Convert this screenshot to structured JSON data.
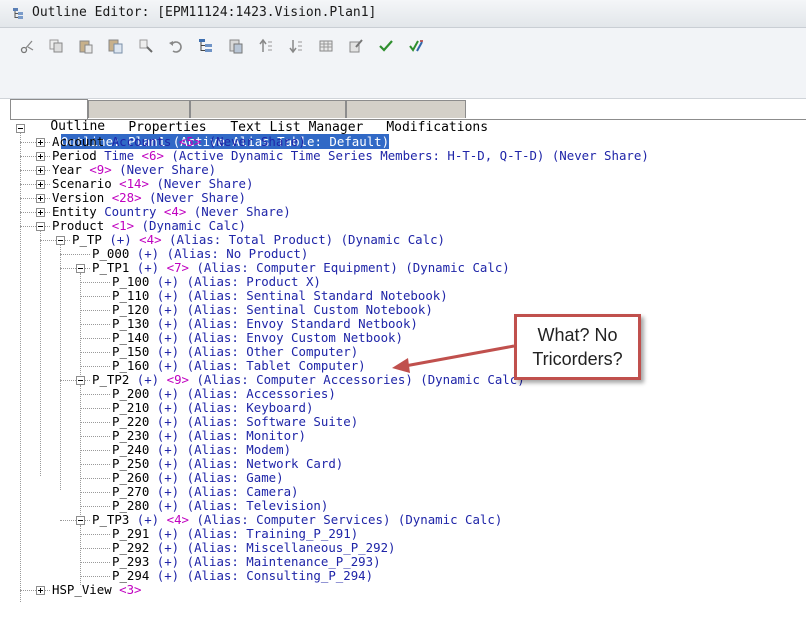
{
  "window": {
    "title": "Outline Editor: [EPM11124:1423.Vision.Plan1]"
  },
  "toolbar": {
    "buttons": [
      "cut-icon",
      "copy-icon",
      "paste-icon",
      "paste-sibling-icon",
      "format-icon",
      "undo-icon",
      "outline-icon",
      "properties-icon",
      "move-up-icon",
      "move-down-icon",
      "grid-icon",
      "edit-icon",
      "verify-icon",
      "save-check-icon"
    ]
  },
  "tabs": [
    {
      "label": "Outline",
      "active": true
    },
    {
      "label": "Properties",
      "active": false
    },
    {
      "label": "Text List Manager",
      "active": false
    },
    {
      "label": "Modifications",
      "active": false
    }
  ],
  "tree": {
    "root": "Outline: Plan1 (Active Alias Table: Default)",
    "rows": [
      {
        "a": "Account ",
        "b": "Accounts ",
        "m": "<5>",
        "c": " (Never Share)"
      },
      {
        "a": "Period ",
        "b": "Time ",
        "m": "<6>",
        "c": " (Active Dynamic Time Series Members: H-T-D, Q-T-D) (Never Share)"
      },
      {
        "a": "Year ",
        "b": "",
        "m": "<9>",
        "c": " (Never Share)"
      },
      {
        "a": "Scenario ",
        "b": "",
        "m": "<14>",
        "c": " (Never Share)"
      },
      {
        "a": "Version ",
        "b": "",
        "m": "<28>",
        "c": " (Never Share)"
      },
      {
        "a": "Entity ",
        "b": "Country ",
        "m": "<4>",
        "c": " (Never Share)"
      },
      {
        "a": "Product ",
        "b": "",
        "m": "<1>",
        "c": " (Dynamic Calc)"
      },
      {
        "a": "P_TP ",
        "b": "(+) ",
        "m": "<4>",
        "c": " (Alias: Total Product) (Dynamic Calc)"
      },
      {
        "a": "P_000 ",
        "b": "(+) ",
        "m": "",
        "c": "(Alias: No Product)"
      },
      {
        "a": "P_TP1 ",
        "b": "(+) ",
        "m": "<7>",
        "c": " (Alias: Computer Equipment) (Dynamic Calc)"
      },
      {
        "a": "P_100 ",
        "b": "(+) ",
        "m": "",
        "c": "(Alias: Product X)"
      },
      {
        "a": "P_110 ",
        "b": "(+) ",
        "m": "",
        "c": "(Alias: Sentinal Standard Notebook)"
      },
      {
        "a": "P_120 ",
        "b": "(+) ",
        "m": "",
        "c": "(Alias: Sentinal Custom Notebook)"
      },
      {
        "a": "P_130 ",
        "b": "(+) ",
        "m": "",
        "c": "(Alias: Envoy Standard Netbook)"
      },
      {
        "a": "P_140 ",
        "b": "(+) ",
        "m": "",
        "c": "(Alias: Envoy Custom Netbook)"
      },
      {
        "a": "P_150 ",
        "b": "(+) ",
        "m": "",
        "c": "(Alias: Other Computer)"
      },
      {
        "a": "P_160 ",
        "b": "(+) ",
        "m": "",
        "c": "(Alias: Tablet Computer)"
      },
      {
        "a": "P_TP2 ",
        "b": "(+) ",
        "m": "<9>",
        "c": " (Alias: Computer Accessories) (Dynamic Calc)"
      },
      {
        "a": "P_200 ",
        "b": "(+) ",
        "m": "",
        "c": "(Alias: Accessories)"
      },
      {
        "a": "P_210 ",
        "b": "(+) ",
        "m": "",
        "c": "(Alias: Keyboard)"
      },
      {
        "a": "P_220 ",
        "b": "(+) ",
        "m": "",
        "c": "(Alias: Software Suite)"
      },
      {
        "a": "P_230 ",
        "b": "(+) ",
        "m": "",
        "c": "(Alias: Monitor)"
      },
      {
        "a": "P_240 ",
        "b": "(+) ",
        "m": "",
        "c": "(Alias: Modem)"
      },
      {
        "a": "P_250 ",
        "b": "(+) ",
        "m": "",
        "c": "(Alias: Network Card)"
      },
      {
        "a": "P_260 ",
        "b": "(+) ",
        "m": "",
        "c": "(Alias: Game)"
      },
      {
        "a": "P_270 ",
        "b": "(+) ",
        "m": "",
        "c": "(Alias: Camera)"
      },
      {
        "a": "P_280 ",
        "b": "(+) ",
        "m": "",
        "c": "(Alias: Television)"
      },
      {
        "a": "P_TP3 ",
        "b": "(+) ",
        "m": "<4>",
        "c": " (Alias: Computer Services) (Dynamic Calc)"
      },
      {
        "a": "P_291 ",
        "b": "(+) ",
        "m": "",
        "c": "(Alias: Training_P_291)"
      },
      {
        "a": "P_292 ",
        "b": "(+) ",
        "m": "",
        "c": "(Alias: Miscellaneous_P_292)"
      },
      {
        "a": "P_293 ",
        "b": "(+) ",
        "m": "",
        "c": "(Alias: Maintenance_P_293)"
      },
      {
        "a": "P_294 ",
        "b": "(+) ",
        "m": "",
        "c": "(Alias: Consulting_P_294)"
      },
      {
        "a": "HSP_View ",
        "b": "",
        "m": "<3>",
        "c": ""
      }
    ]
  },
  "callout": {
    "line1": "What?  No",
    "line2": "Tricorders?"
  },
  "colors": {
    "selection": "#3169c6",
    "member_blue": "#1f25a8",
    "count_magenta": "#c000c0",
    "callout_border": "#c0504d"
  }
}
